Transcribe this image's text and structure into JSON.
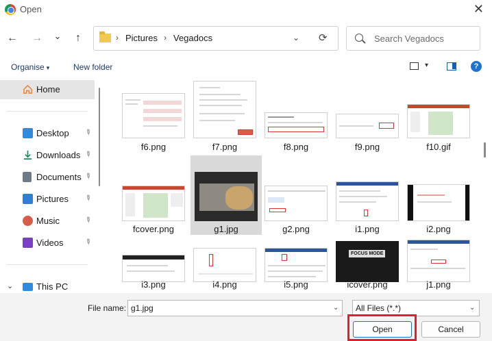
{
  "window": {
    "title": "Open",
    "close": "✕"
  },
  "nav": {
    "back": "←",
    "forward": "→",
    "recent": "⌄",
    "up": "↑"
  },
  "address": {
    "crumbs": [
      "Pictures",
      "Vegadocs"
    ],
    "sep": "›",
    "dropdown": "⌄",
    "refresh": "⟳"
  },
  "search": {
    "placeholder": "Search Vegadocs"
  },
  "toolbar": {
    "organise": "Organise",
    "new_folder": "New folder",
    "caret": "▾",
    "help": "?"
  },
  "sidebar": {
    "items": [
      {
        "label": "Home",
        "icon": "home-icon",
        "color": "#e8813a"
      },
      {
        "label": "Desktop",
        "icon": "desktop-icon",
        "color": "#2e8be0"
      },
      {
        "label": "Downloads",
        "icon": "download-icon",
        "color": "#1f8a5b"
      },
      {
        "label": "Documents",
        "icon": "documents-icon",
        "color": "#6d7a8a"
      },
      {
        "label": "Pictures",
        "icon": "pictures-icon",
        "color": "#2f7fd8"
      },
      {
        "label": "Music",
        "icon": "music-icon",
        "color": "#d85c4a"
      },
      {
        "label": "Videos",
        "icon": "videos-icon",
        "color": "#7a3fc9"
      },
      {
        "label": "This PC",
        "icon": "pc-icon",
        "color": "#2e8be0"
      }
    ],
    "pin": "📌",
    "expand": "›"
  },
  "files": [
    {
      "name": "f6.png"
    },
    {
      "name": "f7.png"
    },
    {
      "name": "f8.png"
    },
    {
      "name": "f9.png"
    },
    {
      "name": "f10.gif"
    },
    {
      "name": "fcover.png"
    },
    {
      "name": "g1.jpg"
    },
    {
      "name": "g2.png"
    },
    {
      "name": "i1.png"
    },
    {
      "name": "i2.png"
    },
    {
      "name": "i3.png"
    },
    {
      "name": "i4.png"
    },
    {
      "name": "i5.png"
    },
    {
      "name": "icover.png"
    },
    {
      "name": "j1.png"
    }
  ],
  "icover_text": "FOCUS MODE",
  "footer": {
    "filename_label": "File name:",
    "filename_value": "g1.jpg",
    "filetype": "All Files (*.*)",
    "caret": "⌄",
    "open": "Open",
    "cancel": "Cancel"
  },
  "colors": {
    "selection": "#d9d9d9",
    "highlight": "#e0202a",
    "accent": "#1a6fd0"
  }
}
